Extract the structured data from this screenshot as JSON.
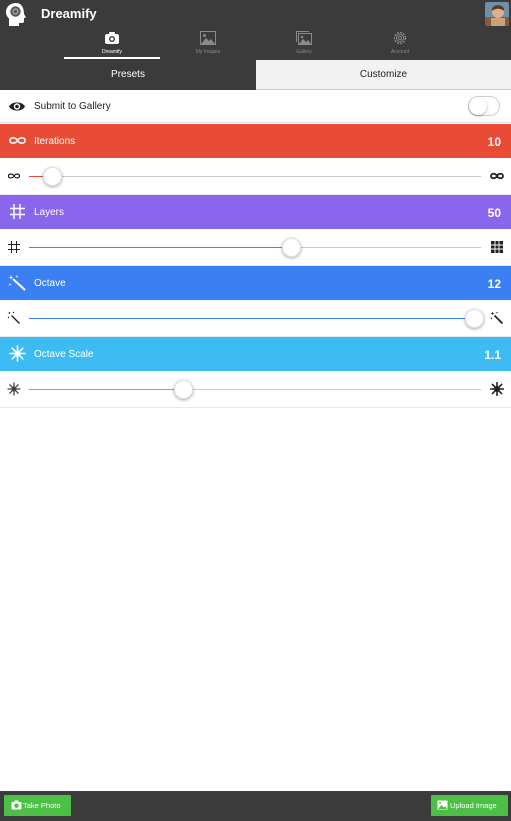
{
  "header": {
    "title": "Dreamify"
  },
  "tabs": [
    {
      "label": "Dreamify",
      "icon": "camera-icon",
      "active": true
    },
    {
      "label": "My Images",
      "icon": "image-icon",
      "active": false
    },
    {
      "label": "Gallery",
      "icon": "gallery-icon",
      "active": false
    },
    {
      "label": "Account",
      "icon": "gear-icon",
      "active": false
    }
  ],
  "segment": {
    "presets_label": "Presets",
    "customize_label": "Customize",
    "selected": "Presets"
  },
  "submit": {
    "label": "Submit to Gallery",
    "enabled": false
  },
  "settings": {
    "iterations": {
      "label": "Iterations",
      "value": "10",
      "color": "#e84b36",
      "fill_color": "#e84b36",
      "level": 0.05,
      "min_icon": "infinity-icon",
      "max_icon": "infinity-icon"
    },
    "layers": {
      "label": "Layers",
      "value": "50",
      "color": "#8a66ec",
      "fill_color": "#8a66ec",
      "level": 0.58,
      "min_icon": "grid-icon",
      "max_icon": "grid-filled-icon"
    },
    "octave": {
      "label": "Octave",
      "value": "12",
      "color": "#3a80f2",
      "fill_color": "#3a80f2",
      "level": 0.985,
      "min_icon": "magic-wand-icon",
      "max_icon": "magic-wand-icon"
    },
    "octave_scale": {
      "label": "Octave Scale",
      "value": "1.1",
      "color": "#3cbcf3",
      "fill_color": "#3cbcf3",
      "level": 0.34,
      "min_icon": "snowflake-icon",
      "max_icon": "snowflake-icon"
    }
  },
  "bottom": {
    "take_photo_label": "Take Photo",
    "upload_image_label": "Upload Image",
    "button_color": "#4cbf46"
  }
}
